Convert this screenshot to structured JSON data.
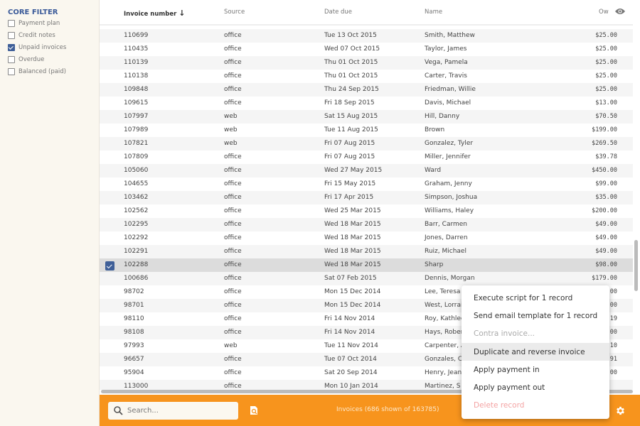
{
  "sidebar": {
    "title": "CORE FILTER",
    "filters": [
      {
        "label": "Payment plan",
        "checked": false
      },
      {
        "label": "Credit notes",
        "checked": false
      },
      {
        "label": "Unpaid invoices",
        "checked": true
      },
      {
        "label": "Overdue",
        "checked": false
      },
      {
        "label": "Balanced (paid)",
        "checked": false
      }
    ]
  },
  "table": {
    "headers": {
      "invoice": "Invoice number",
      "source": "Source",
      "date": "Date due",
      "name": "Name",
      "amount": "Ow"
    },
    "sort": "descending",
    "rows": [
      [
        "110699",
        "office",
        "Tue 13 Oct 2015",
        "Smith, Matthew",
        "$25.00"
      ],
      [
        "110435",
        "office",
        "Wed 07 Oct 2015",
        "Taylor, James",
        "$25.00"
      ],
      [
        "110139",
        "office",
        "Thu 01 Oct 2015",
        "Vega, Pamela",
        "$25.00"
      ],
      [
        "110138",
        "office",
        "Thu 01 Oct 2015",
        "Carter, Travis",
        "$25.00"
      ],
      [
        "109848",
        "office",
        "Thu 24 Sep 2015",
        "Friedman, Willie",
        "$25.00"
      ],
      [
        "109615",
        "office",
        "Fri 18 Sep 2015",
        "Davis, Michael",
        "$13.00"
      ],
      [
        "107997",
        "web",
        "Sat 15 Aug 2015",
        "Hill, Danny",
        "$70.50"
      ],
      [
        "107989",
        "web",
        "Tue 11 Aug 2015",
        "Brown",
        "$199.00"
      ],
      [
        "107821",
        "web",
        "Fri 07 Aug 2015",
        "Gonzalez, Tyler",
        "$269.50"
      ],
      [
        "107809",
        "office",
        "Fri 07 Aug 2015",
        "Miller, Jennifer",
        "$39.78"
      ],
      [
        "105060",
        "office",
        "Wed 27 May 2015",
        "Ward",
        "$450.00"
      ],
      [
        "104655",
        "office",
        "Fri 15 May 2015",
        "Graham, Jenny",
        "$99.00"
      ],
      [
        "103462",
        "office",
        "Fri 17 Apr 2015",
        "Simpson, Joshua",
        "$35.00"
      ],
      [
        "102562",
        "office",
        "Wed 25 Mar 2015",
        "Williams, Haley",
        "$200.00"
      ],
      [
        "102295",
        "office",
        "Wed 18 Mar 2015",
        "Barr, Carmen",
        "$49.00"
      ],
      [
        "102292",
        "office",
        "Wed 18 Mar 2015",
        "Jones, Darren",
        "$49.00"
      ],
      [
        "102291",
        "office",
        "Wed 18 Mar 2015",
        "Ruiz, Michael",
        "$49.00"
      ],
      [
        "102288",
        "office",
        "Wed 18 Mar 2015",
        "Sharp",
        "$98.00"
      ],
      [
        "100686",
        "office",
        "Sat 07 Feb 2015",
        "Dennis, Morgan",
        "$179.00"
      ],
      [
        "98702",
        "office",
        "Mon 15 Dec 2014",
        "Lee, Teresa",
        "00"
      ],
      [
        "98701",
        "office",
        "Mon 15 Dec 2014",
        "West, Lorrai",
        "00"
      ],
      [
        "98110",
        "office",
        "Fri 14 Nov 2014",
        "Roy, Kathlee",
        "19"
      ],
      [
        "98108",
        "office",
        "Fri 14 Nov 2014",
        "Hays, Rober",
        "00"
      ],
      [
        "97993",
        "web",
        "Tue 11 Nov 2014",
        "Carpenter, A",
        "10"
      ],
      [
        "96657",
        "office",
        "Tue 07 Oct 2014",
        "Gonzales, C",
        "91"
      ],
      [
        "95904",
        "office",
        "Sat 20 Sep 2014",
        "Henry, Jean",
        "00"
      ],
      [
        "113000",
        "office",
        "Mon 10 Jan 2014",
        "Martinez, S",
        ""
      ]
    ],
    "selected_row": "102288"
  },
  "footer": {
    "search_placeholder": "Search...",
    "status": "Invoices (686 shown of 163785)",
    "accent": "#f7941d"
  },
  "context_menu": {
    "items": [
      {
        "label": "Execute script for 1 record",
        "state": "normal"
      },
      {
        "label": "Send email template for 1 record",
        "state": "normal"
      },
      {
        "label": "Contra invoice...",
        "state": "disabled"
      },
      {
        "label": "Duplicate and reverse invoice",
        "state": "hover"
      },
      {
        "label": "Apply payment in",
        "state": "normal"
      },
      {
        "label": "Apply payment out",
        "state": "normal"
      },
      {
        "label": "Delete record",
        "state": "danger"
      }
    ]
  }
}
